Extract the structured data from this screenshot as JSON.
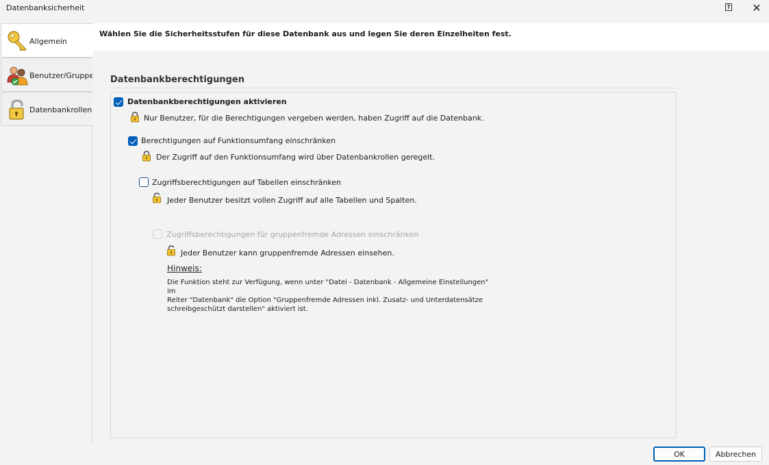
{
  "window": {
    "title": "Datenbanksicherheit",
    "help_glyph": "?",
    "close_glyph": "✕"
  },
  "sidebar": {
    "items": [
      {
        "label": "Allgemein",
        "icon": "key-icon",
        "active": true
      },
      {
        "label": "Benutzer/Gruppen",
        "icon": "users-icon",
        "active": false
      },
      {
        "label": "Datenbankrollen",
        "icon": "padlock-icon",
        "active": false
      }
    ]
  },
  "main": {
    "description": "Wählen Sie die Sicherheitsstufen für diese Datenbank aus und legen Sie deren Einzelheiten fest.",
    "section_title": "Datenbankberechtigungen",
    "options": [
      {
        "label": "Datenbankberechtigungen aktivieren",
        "state": "checked",
        "info": "Nur Benutzer, für die Berechtigungen vergeben werden,  haben Zugriff auf die Datenbank.",
        "lock": "closed"
      },
      {
        "label": "Berechtigungen auf Funktionsumfang einschränken",
        "state": "checked",
        "info": "Der Zugriff auf den Funktionsumfang wird über Datenbankrollen geregelt.",
        "lock": "closed"
      },
      {
        "label": "Zugriffsberechtigungen auf Tabellen einschränken",
        "state": "unchecked",
        "info": "Jeder Benutzer besitzt vollen Zugriff auf alle Tabellen und Spalten.",
        "lock": "open"
      },
      {
        "label": "Zugriffsberechtigungen für gruppenfremde Adressen einschränken",
        "state": "disabled",
        "info": "Jeder Benutzer kann gruppenfremde Adressen einsehen.",
        "lock": "open"
      }
    ],
    "hint": {
      "title": "Hinweis:",
      "lines": [
        "Die Funktion steht zur Verfügung, wenn unter \"Datei - Datenbank - Allgemeine Einstellungen\" im",
        "Reiter \"Datenbank\" die Option \"Gruppenfremde Adressen inkl. Zusatz- und Unterdatensätze",
        "schreibgeschützt darstellen\" aktiviert ist."
      ]
    }
  },
  "footer": {
    "ok_label": "OK",
    "cancel_label": "Abbrechen"
  },
  "colors": {
    "accent": "#005fb8",
    "lock_gold": "#e8b400"
  }
}
